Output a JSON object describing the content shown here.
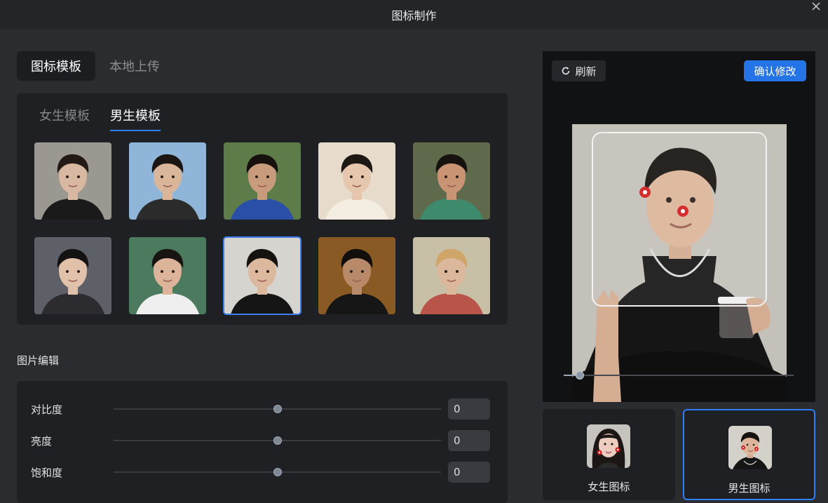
{
  "window": {
    "title": "图标制作"
  },
  "main_tabs": [
    {
      "label": "图标模板",
      "active": true
    },
    {
      "label": "本地上传",
      "active": false
    }
  ],
  "sub_tabs": [
    {
      "label": "女生模板",
      "active": false
    },
    {
      "label": "男生模板",
      "active": true
    }
  ],
  "templates": [
    {
      "bg": "#9a9890",
      "skin": "#d8b8a0",
      "hair": "#231a15",
      "shirt": "#1a1a1a",
      "selected": false
    },
    {
      "bg": "#8fb6d8",
      "skin": "#d9b59a",
      "hair": "#1b1612",
      "shirt": "#2b2b2b",
      "selected": false
    },
    {
      "bg": "#5e7c4a",
      "skin": "#c99b7d",
      "hair": "#16110e",
      "shirt": "#2a4fa8",
      "selected": false
    },
    {
      "bg": "#e7dccb",
      "skin": "#e6c6ad",
      "hair": "#1e1814",
      "shirt": "#f3ede2",
      "selected": false
    },
    {
      "bg": "#5f6a4c",
      "skin": "#c89474",
      "hair": "#17120f",
      "shirt": "#3d8a6c",
      "selected": false
    },
    {
      "bg": "#5d6066",
      "skin": "#e2c1aa",
      "hair": "#141212",
      "shirt": "#2b2b30",
      "selected": false
    },
    {
      "bg": "#4c7a5e",
      "skin": "#dcb49a",
      "hair": "#181411",
      "shirt": "#efefef",
      "selected": false
    },
    {
      "bg": "#d6d4cf",
      "skin": "#dcb89f",
      "hair": "#161210",
      "shirt": "#151515",
      "selected": true
    },
    {
      "bg": "#8a5a24",
      "skin": "#b98a6a",
      "hair": "#120f0c",
      "shirt": "#161616",
      "selected": false
    },
    {
      "bg": "#c8c0a6",
      "skin": "#dbb89c",
      "hair": "#cfa56a",
      "shirt": "#b9544a",
      "selected": false
    }
  ],
  "edit": {
    "title": "图片编辑",
    "rows": [
      {
        "label": "对比度",
        "value": "0",
        "level": 0.5
      },
      {
        "label": "亮度",
        "value": "0",
        "level": 0.5
      },
      {
        "label": "饱和度",
        "value": "0",
        "level": 0.5
      }
    ]
  },
  "preview": {
    "refresh_label": "刷新",
    "confirm_label": "确认修改",
    "zoom_level": 0.07
  },
  "icon_cards": [
    {
      "label": "女生图标",
      "active": false
    },
    {
      "label": "男生图标",
      "active": true
    }
  ],
  "colors": {
    "accent": "#2f7ff7",
    "confirm": "#2474e8",
    "panel": "#1f2023",
    "background": "#2b2c30"
  }
}
